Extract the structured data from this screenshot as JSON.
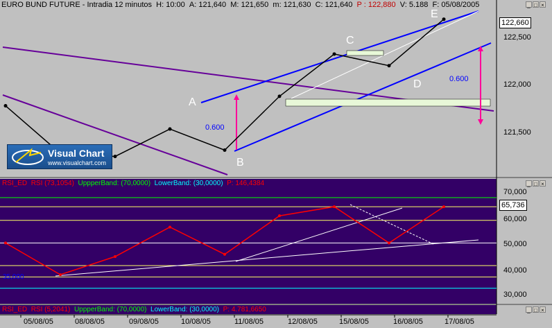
{
  "header": {
    "instrument": "EURO BUND FUTURE",
    "timeframe": "Intradia 12 minutos",
    "h_label": "H:",
    "h_val": "10:00",
    "a_label": "A:",
    "a_val": "121,640",
    "m_label": "M:",
    "m_val": "121,650",
    "n_label": "m:",
    "n_val": "121,630",
    "c_label": "C:",
    "c_val": "121,640",
    "p_label": "P :",
    "p_val": "122,880",
    "v_label": "V:",
    "v_val": "5.188",
    "f_label": "F:",
    "f_val": "05/08/2005"
  },
  "price_panel": {
    "last_price": "122,660",
    "y_ticks": [
      "122,500",
      "122,000",
      "121,500"
    ],
    "points": [
      "A",
      "B",
      "C",
      "D",
      "E"
    ],
    "fib_labels": [
      "0.600",
      "0.600"
    ]
  },
  "logo": {
    "name": "Visual Chart",
    "url": "www.visualchart.com"
  },
  "rsi_panel": {
    "label1": "RSI_ED",
    "label2": "RSI",
    "label2_val": "(73,1054)",
    "upper_label": "UppperBand:",
    "upper_val": "(70,0000)",
    "lower_label": "LowerBand:",
    "lower_val": "(30,0000)",
    "p_label": "P:",
    "p_val": "146,4384",
    "last_value": "65,736",
    "y_ticks": [
      "70,000",
      "60,000",
      "50,000",
      "40,000",
      "30,000"
    ],
    "left_marker": "35,000"
  },
  "bottom_panel": {
    "label1": "RSI_ED",
    "label2": "RSI",
    "label2_val": "(5,2041)",
    "upper_label": "UppperBand:",
    "upper_val": "(70,0000)",
    "lower_label": "LowerBand:",
    "lower_val": "(30,0000)",
    "p_label": "P:",
    "p_val": "4.781,6650"
  },
  "x_axis": [
    "05/08/05",
    "08/08/05",
    "09/08/05",
    "10/08/05",
    "11/08/05",
    "12/08/05",
    "15/08/05",
    "16/08/05",
    "17/08/05"
  ],
  "chart_data": {
    "type": "line",
    "title": "EURO BUND FUTURE - Intradia 12 minutos",
    "x": [
      "05/08/05",
      "08/08/05",
      "09/08/05",
      "10/08/05",
      "11/08/05",
      "12/08/05",
      "15/08/05",
      "16/08/05",
      "17/08/05"
    ],
    "series": [
      {
        "name": "",
        "values": [
          121.84,
          121.39,
          121.36,
          121.62,
          121.42,
          121.93,
          122.33,
          122.22,
          122.66
        ]
      },
      {
        "name": "RSI",
        "values": [
          50,
          36,
          44,
          57,
          45,
          62,
          66,
          50,
          66
        ]
      }
    ],
    "price_ylim": [
      121.2,
      122.75
    ],
    "rsi_ylim": [
      25,
      74
    ],
    "rsi_bands": [
      70,
      30
    ],
    "grid": false,
    "colors": {
      "price_bg": "#c0c0c0",
      "rsi_bg": "#330066",
      "channel": "#0000ff",
      "trend": "#660099",
      "rsi_line": "#ff0000",
      "ma": "#ff0000",
      "marker": "#ff0099"
    }
  }
}
